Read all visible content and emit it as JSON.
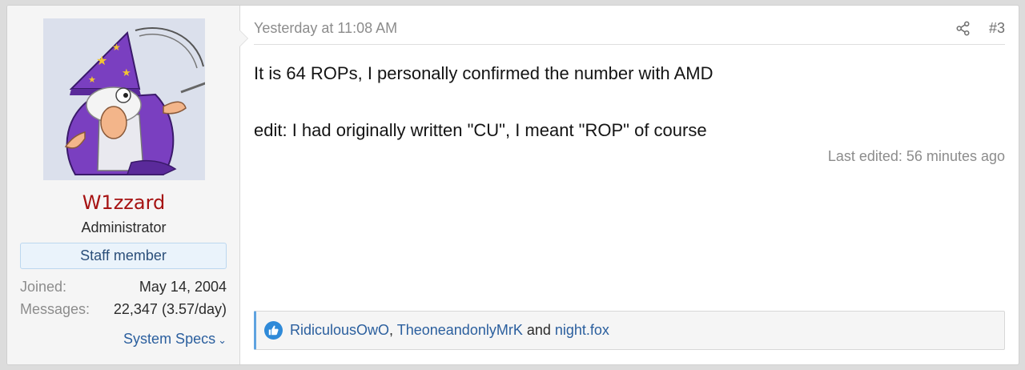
{
  "user": {
    "name": "W1zzard",
    "title": "Administrator",
    "badge": "Staff member",
    "stats": [
      {
        "label": "Joined:",
        "value": "May 14, 2004"
      },
      {
        "label": "Messages:",
        "value": "22,347 (3.57/day)"
      }
    ],
    "specs_link": "System Specs",
    "name_color": "#a61313"
  },
  "post": {
    "date": "Yesterday at 11:08 AM",
    "number": "#3",
    "body": [
      "It is 64 ROPs, I personally confirmed the number with AMD",
      "edit: I had originally written \"CU\", I meant \"ROP\" of course"
    ],
    "last_edited": "Last edited: 56 minutes ago"
  },
  "reactions": {
    "users": [
      "RidiculousOwO",
      "TheoneandonlyMrK",
      "night.fox"
    ],
    "sep1": ", ",
    "sep2": " and ",
    "accent": "#5fa3e0",
    "icon": "like-icon"
  },
  "icons": {
    "share": "share-icon",
    "chevron": "chevron-down-icon"
  }
}
